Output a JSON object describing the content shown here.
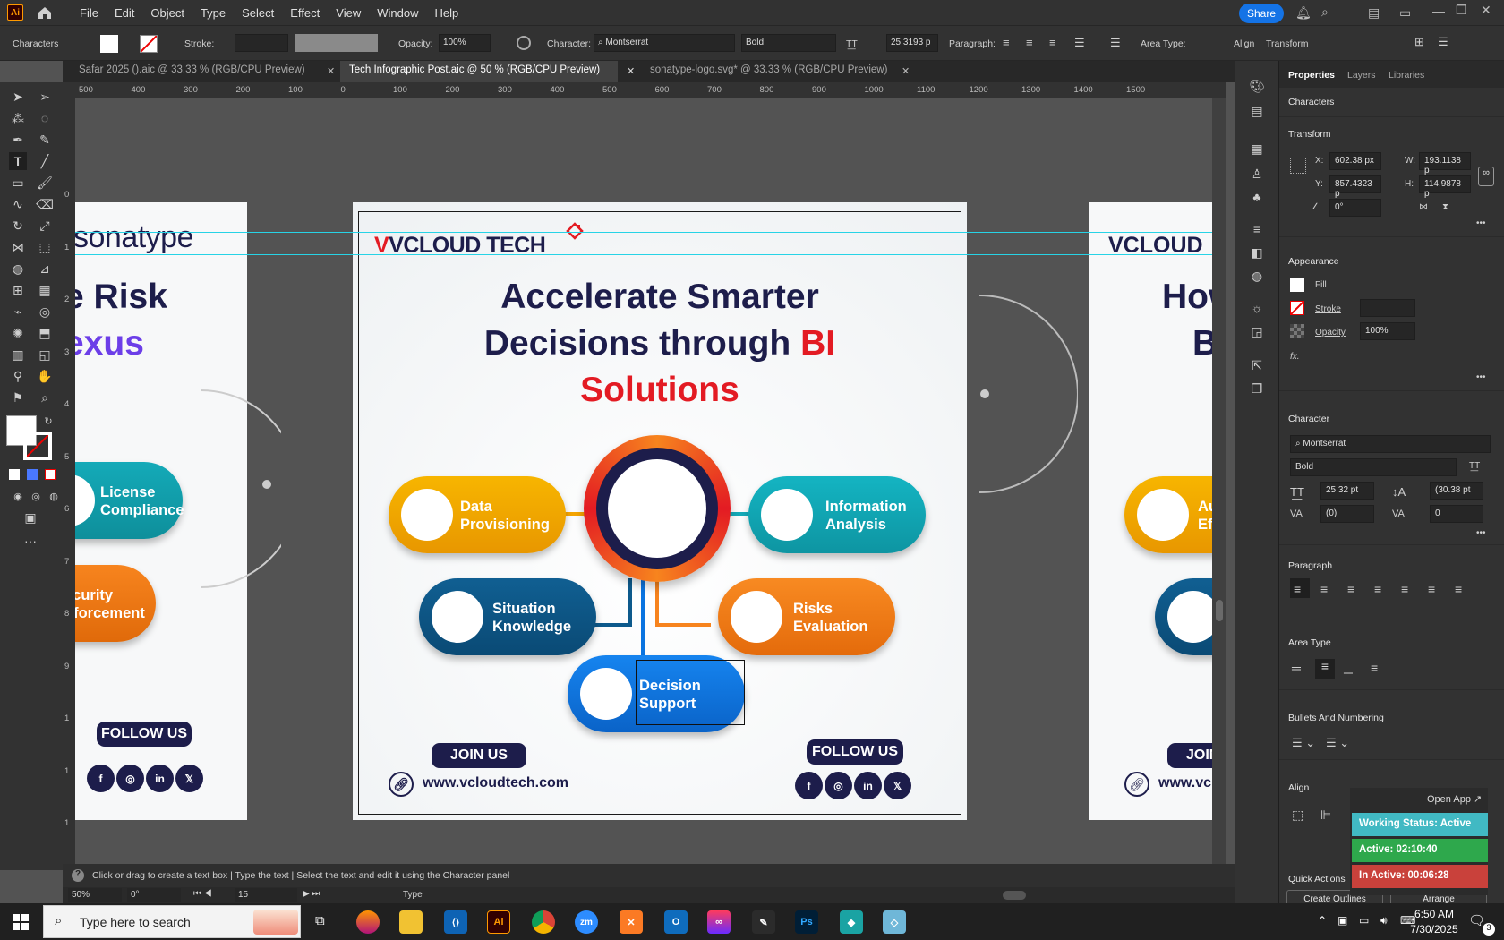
{
  "app": {
    "logo": "Ai",
    "menus": [
      "File",
      "Edit",
      "Object",
      "Type",
      "Select",
      "Effect",
      "View",
      "Window",
      "Help"
    ],
    "share": "Share"
  },
  "control": {
    "characters": "Characters",
    "stroke": "Stroke:",
    "opacity_label": "Opacity:",
    "opacity": "100%",
    "character_label": "Character:",
    "font": "Montserrat",
    "style": "Bold",
    "size": "25.3193 p",
    "paragraph": "Paragraph:",
    "area_type": "Area Type:",
    "align": "Align",
    "transform": "Transform"
  },
  "tabs": [
    {
      "label": "Safar 2025 ().aic @ 33.33 % (RGB/CPU Preview)"
    },
    {
      "label": "Tech Infographic Post.aic @ 50 % (RGB/CPU Preview)"
    },
    {
      "label": "sonatype-logo.svg* @ 33.33 % (RGB/CPU Preview)"
    }
  ],
  "ruler": {
    "top": [
      "500",
      "400",
      "300",
      "200",
      "100",
      "0",
      "100",
      "200",
      "300",
      "400",
      "500",
      "600",
      "700",
      "800",
      "900",
      "1000",
      "1100",
      "1200",
      "1300",
      "1400",
      "1500"
    ],
    "left": [
      "0",
      "1",
      "2",
      "3",
      "4",
      "5",
      "6",
      "7",
      "8",
      "9",
      "1",
      "1",
      "1"
    ]
  },
  "left_artboard": {
    "logo": "sonatype",
    "line1": "e Risk",
    "line2": "exus",
    "pill1": [
      "License",
      "Compliance"
    ],
    "pill2": [
      "ecurity",
      "nforcement"
    ],
    "follow": "FOLLOW US",
    "socials": [
      "f",
      "◎",
      "in",
      "𝕏"
    ]
  },
  "main_artboard": {
    "logo": "VCLOUD TECH",
    "title_line1": "Accelerate Smarter",
    "title_line2_dark": "Decisions through ",
    "title_line2_red": "BI",
    "title_line3": "Solutions",
    "pills": [
      {
        "l1": "Data",
        "l2": "Provisioning"
      },
      {
        "l1": "Information",
        "l2": "Analysis"
      },
      {
        "l1": "Situation",
        "l2": "Knowledge"
      },
      {
        "l1": "Risks",
        "l2": "Evaluation"
      },
      {
        "l1": "Decision",
        "l2": "Support"
      }
    ],
    "join": "JOIN US",
    "follow": "FOLLOW US",
    "website": "www.vcloudtech.com",
    "socials": [
      "f",
      "◎",
      "in",
      "𝕏"
    ]
  },
  "right_artboard": {
    "logo": "VCLOUD",
    "line1": "How",
    "line2": "Ba",
    "pill1": [
      "Auto",
      "Effic"
    ],
    "join": "JOIN US",
    "website": "www.vclo"
  },
  "status": {
    "hint": "Click or drag to create a text box  |  Type the text  |  Select the text and edit it using the Character panel",
    "zoom": "50%",
    "rotation": "0°",
    "artboard": "15",
    "mode": "Type"
  },
  "panel": {
    "tabs": [
      "Properties",
      "Layers",
      "Libraries"
    ],
    "characters": "Characters",
    "transform": "Transform",
    "x": "602.38 px",
    "y": "857.4323 p",
    "w": "193.1138 p",
    "h": "114.9878 p",
    "angle": "0°",
    "appearance": "Appearance",
    "fill": "Fill",
    "stroke": "Stroke",
    "opacity": "Opacity",
    "opacity_val": "100%",
    "fx": "fx.",
    "character": "Character",
    "font": "Montserrat",
    "style": "Bold",
    "size": "25.32 pt",
    "leading": "(30.38 pt",
    "kerning": "(0)",
    "tracking": "0",
    "paragraph": "Paragraph",
    "area_type": "Area Type",
    "bullets": "Bullets And Numbering",
    "align": "Align",
    "quick": "Quick Actions",
    "create_outlines": "Create Outlines",
    "arrange": "Arrange"
  },
  "widget": {
    "open": "Open App ↗",
    "working": "Working Status: Active",
    "active": "Active: 02:10:40",
    "inactive": "In Active: 00:06:28"
  },
  "taskbar": {
    "search": "Type here to search",
    "time": "6:50 AM",
    "date": "7/30/2025",
    "notif": "3"
  },
  "colors": {
    "navy": "#1d1d4b",
    "red": "#e31b23",
    "yellow": "#f5a500",
    "teal": "#14aab8",
    "blue": "#0d5a8c",
    "orange": "#f7841e",
    "bright": "#0a74e0"
  }
}
